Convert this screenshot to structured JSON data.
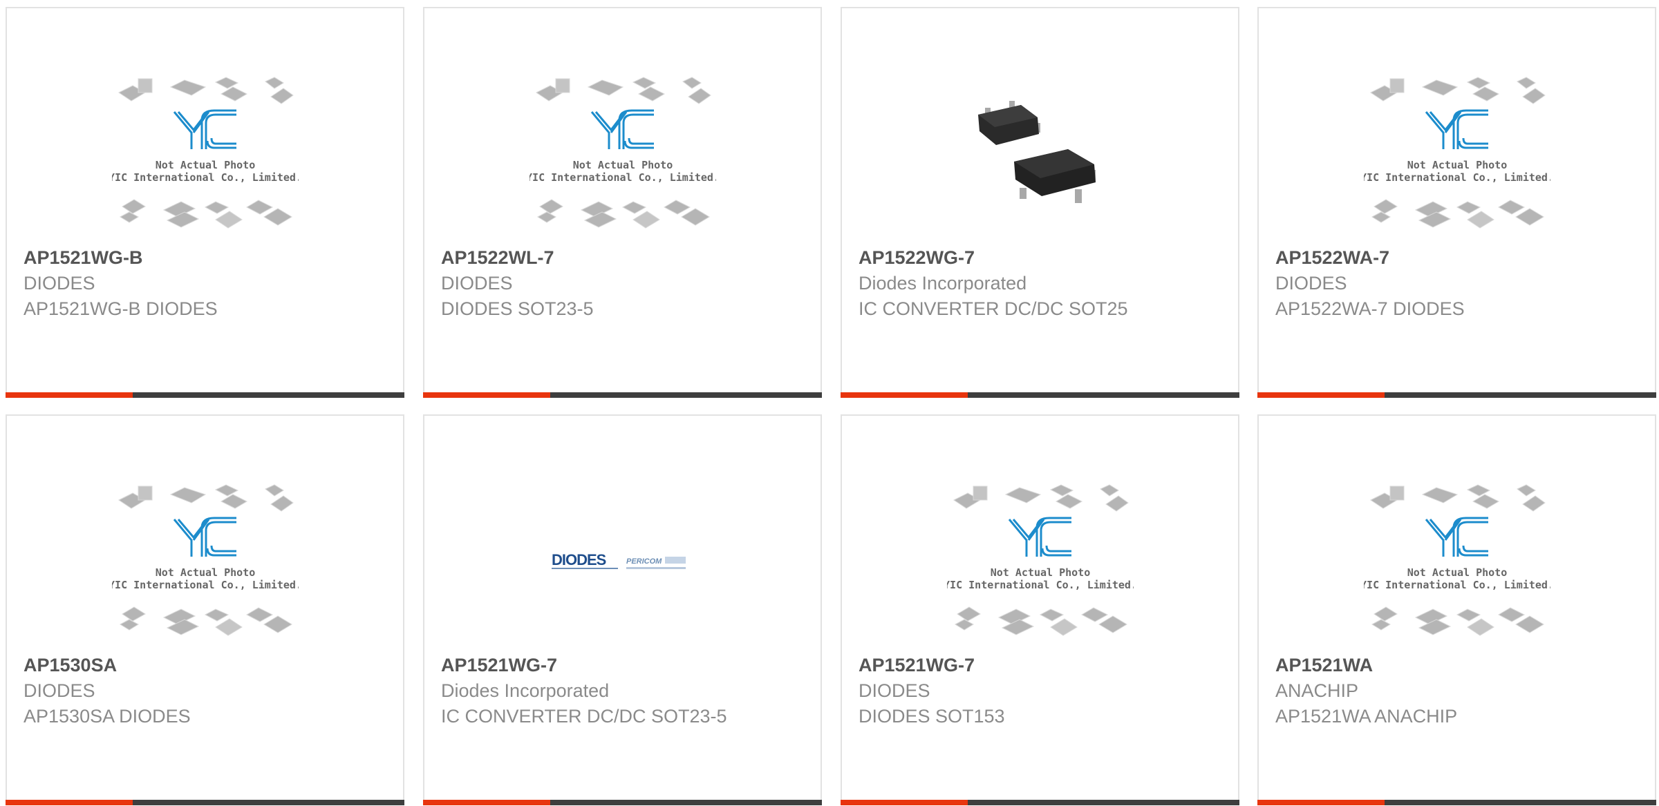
{
  "placeholder": {
    "line1": "Not Actual Photo",
    "line2": "YIC International Co., Limited."
  },
  "diodes_logo": {
    "brand1": "DIODES",
    "brand2": "PERICOM"
  },
  "colors": {
    "accent": "#e8350e",
    "bar": "#3e3e3e",
    "logo_blue": "#1c8ccc"
  },
  "products": [
    {
      "part": "AP1521WG-B",
      "manufacturer": "DIODES",
      "description": "AP1521WG-B DIODES",
      "image": "yic-placeholder"
    },
    {
      "part": "AP1522WL-7",
      "manufacturer": "DIODES",
      "description": "DIODES SOT23-5",
      "image": "yic-placeholder"
    },
    {
      "part": "AP1522WG-7",
      "manufacturer": "Diodes Incorporated",
      "description": "IC CONVERTER DC/DC SOT25",
      "image": "sot25-package"
    },
    {
      "part": "AP1522WA-7",
      "manufacturer": "DIODES",
      "description": "AP1522WA-7 DIODES",
      "image": "yic-placeholder"
    },
    {
      "part": "AP1530SA",
      "manufacturer": "DIODES",
      "description": "AP1530SA DIODES",
      "image": "yic-placeholder"
    },
    {
      "part": "AP1521WG-7",
      "manufacturer": "Diodes Incorporated",
      "description": "IC CONVERTER DC/DC SOT23-5",
      "image": "diodes-logo"
    },
    {
      "part": "AP1521WG-7",
      "manufacturer": "DIODES",
      "description": "DIODES SOT153",
      "image": "yic-placeholder"
    },
    {
      "part": "AP1521WA",
      "manufacturer": "ANACHIP",
      "description": "AP1521WA ANACHIP",
      "image": "yic-placeholder"
    }
  ]
}
